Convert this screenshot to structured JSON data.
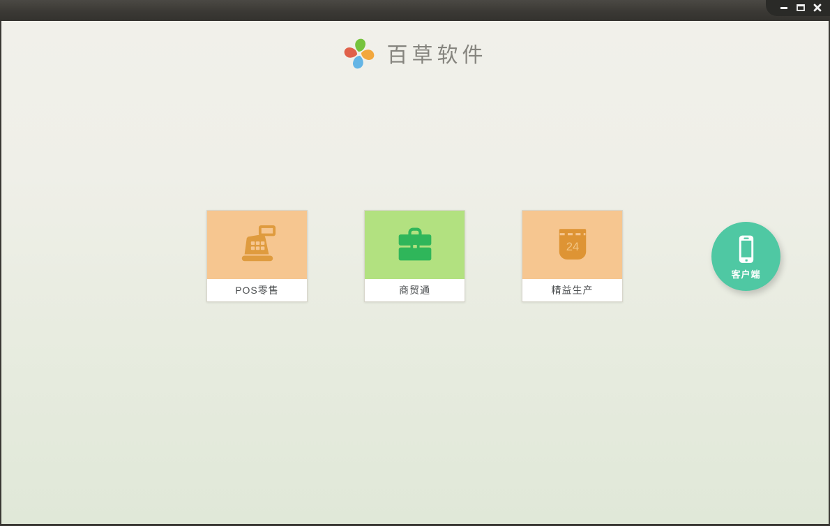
{
  "window": {
    "controls": [
      {
        "icon": "minimize-icon",
        "name": "minimize"
      },
      {
        "icon": "maximize-icon",
        "name": "maximize"
      },
      {
        "icon": "close-icon",
        "name": "close"
      }
    ],
    "titlebar_color": "#3b3935"
  },
  "header": {
    "app_name": "百草软件",
    "logo": "pinwheel-logo",
    "logo_petal_colors": [
      "#76c33d",
      "#f2a73d",
      "#64b5e5",
      "#e0614a"
    ]
  },
  "products": [
    {
      "label": "POS零售",
      "icon": "cash-register-icon",
      "tile_color": "#f6c690",
      "icon_color": "#df9b3e"
    },
    {
      "label": "商贸通",
      "icon": "briefcase-icon",
      "tile_color": "#b2e180",
      "icon_color": "#2fb65a"
    },
    {
      "label": "精益生产",
      "icon": "calendar-icon",
      "calendar_day": "24",
      "tile_color": "#f6c690",
      "icon_color": "#de9434"
    }
  ],
  "client_button": {
    "label": "客户端",
    "icon": "smartphone-icon",
    "color": "#4fc8a3"
  },
  "colors": {
    "background_top": "#f1f0ea",
    "background_bottom": "#e0e8d8",
    "card_border": "#d8d6cb",
    "label_text": "#4b4e50",
    "brand_text": "#85847e"
  }
}
